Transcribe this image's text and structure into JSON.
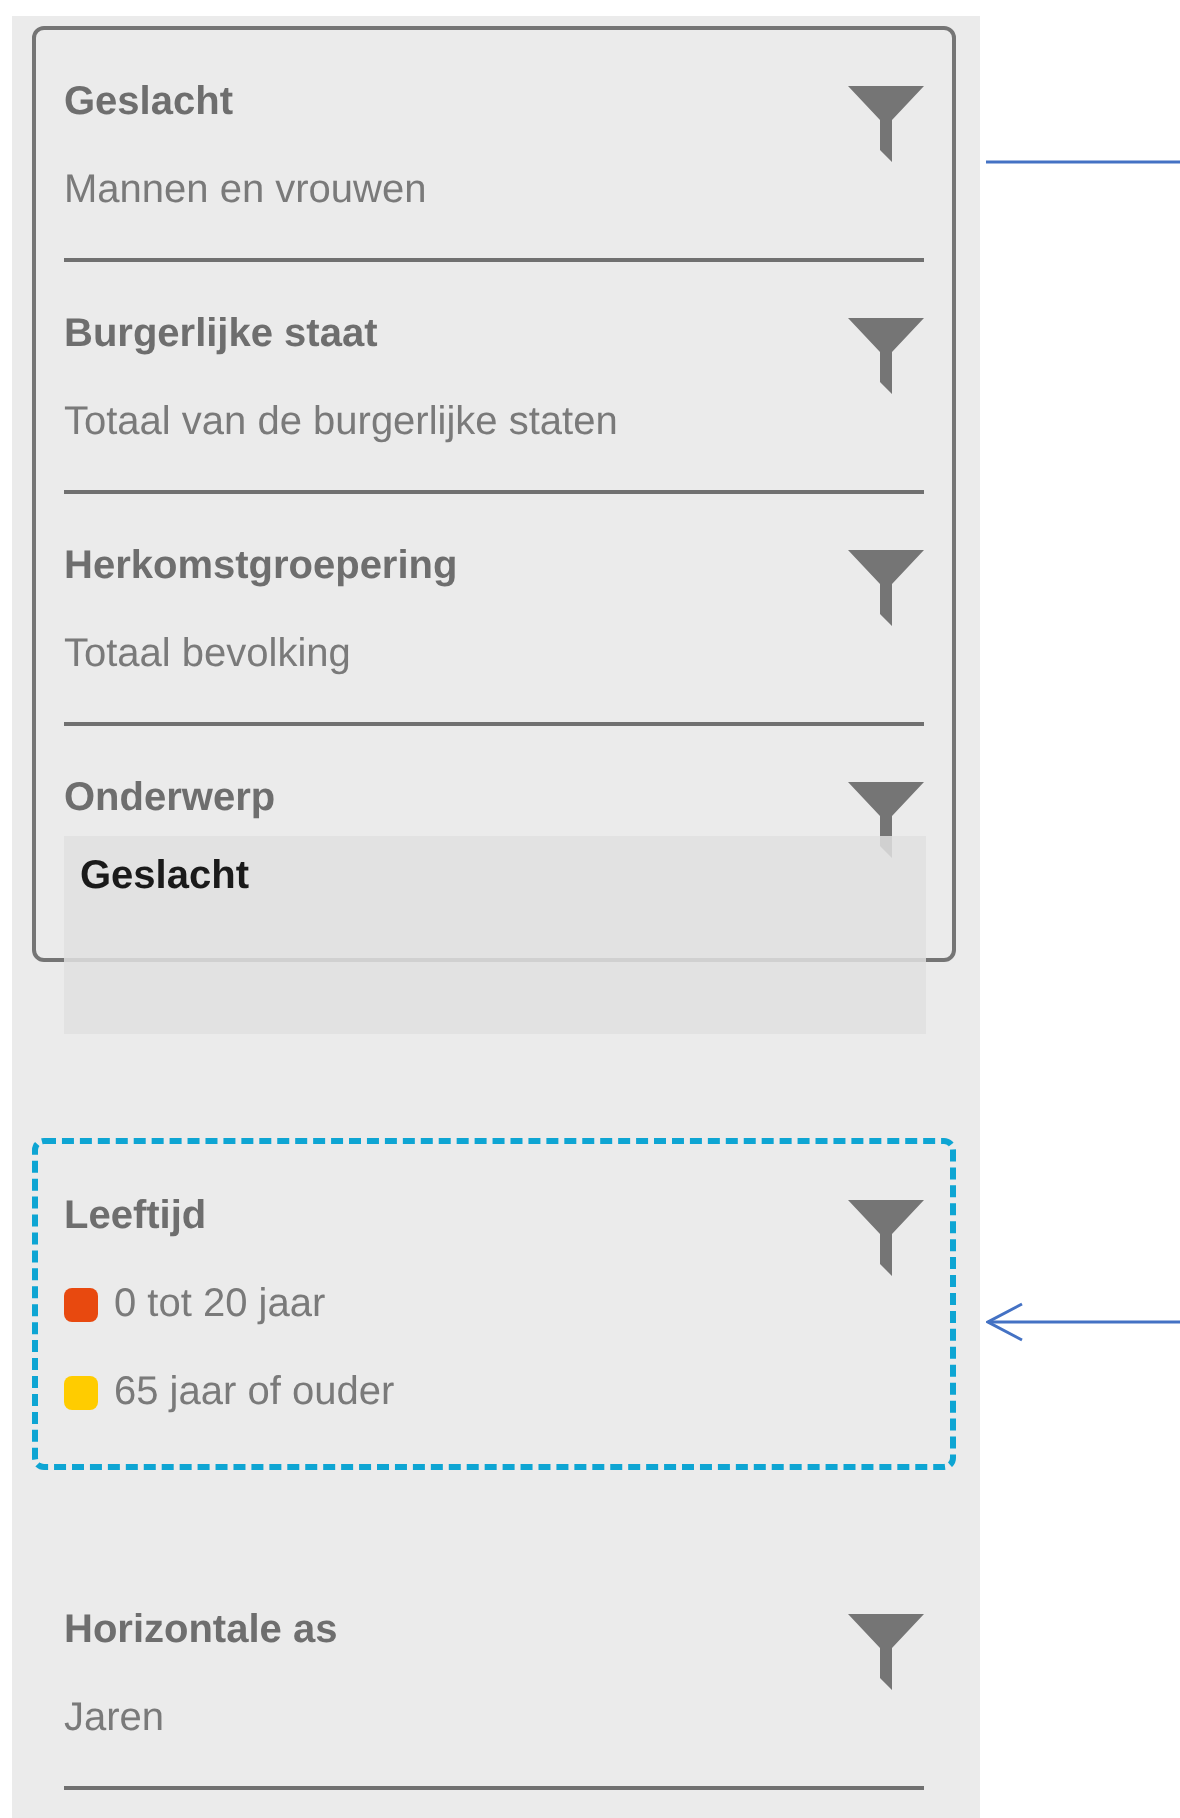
{
  "groups": [
    {
      "kind": "solid",
      "items": [
        {
          "title": "Geslacht",
          "values": [
            {
              "label": "Mannen en vrouwen"
            }
          ]
        },
        {
          "title": "Burgerlijke staat",
          "values": [
            {
              "label": "Totaal van de burgerlijke staten"
            }
          ]
        },
        {
          "title": "Herkomstgroepering",
          "values": [
            {
              "label": "Totaal bevolking"
            }
          ]
        },
        {
          "title": "Onderwerp"
        }
      ]
    },
    {
      "kind": "dashed",
      "items": [
        {
          "title": "Leeftijd",
          "values": [
            {
              "label": "0 tot 20 jaar",
              "color": "#e8490f"
            },
            {
              "label": "65 jaar of ouder",
              "color": "#ffcc00"
            }
          ]
        }
      ]
    },
    {
      "kind": "plain",
      "items": [
        {
          "title": "Horizontale as",
          "values": [
            {
              "label": "Jaren"
            }
          ]
        }
      ]
    }
  ],
  "drag_ghost": {
    "label": "Geslacht"
  }
}
